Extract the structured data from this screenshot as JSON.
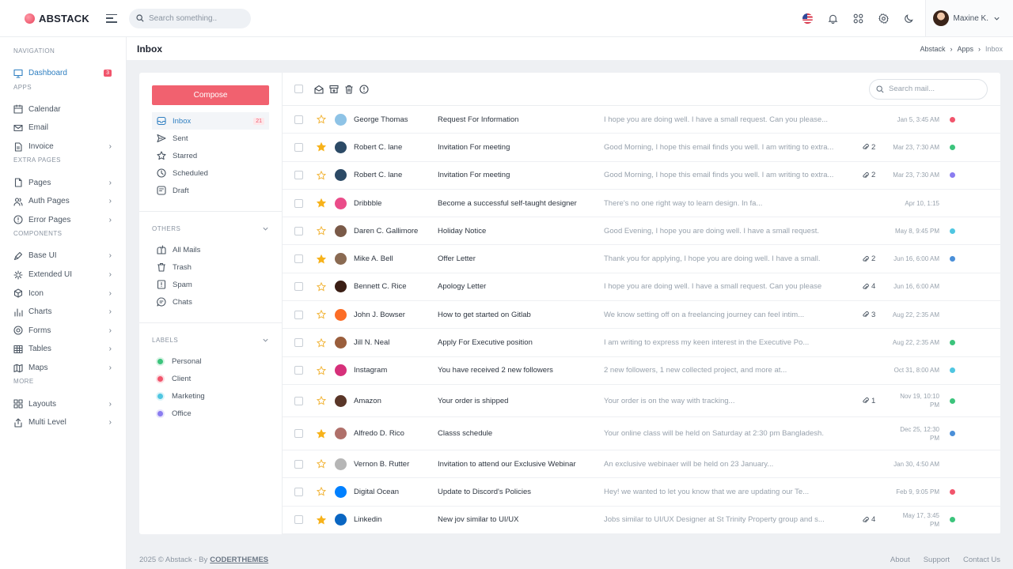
{
  "app": {
    "brand": "ABSTACK",
    "search_placeholder": "Search something..",
    "user_name": "Maxine K."
  },
  "sidebar": {
    "sections": [
      {
        "title": "NAVIGATION",
        "items": [
          {
            "label": "Dashboard",
            "icon": "monitor-icon",
            "badge": "3",
            "active": true
          }
        ]
      },
      {
        "title": "APPS",
        "items": [
          {
            "label": "Calendar",
            "icon": "calendar-icon"
          },
          {
            "label": "Email",
            "icon": "mail-icon"
          },
          {
            "label": "Invoice",
            "icon": "file-icon",
            "chevron": true
          }
        ]
      },
      {
        "title": "EXTRA PAGES",
        "items": [
          {
            "label": "Pages",
            "icon": "page-icon",
            "chevron": true
          },
          {
            "label": "Auth Pages",
            "icon": "users-icon",
            "chevron": true
          },
          {
            "label": "Error Pages",
            "icon": "alert-icon",
            "chevron": true
          }
        ]
      },
      {
        "title": "COMPONENTS",
        "items": [
          {
            "label": "Base UI",
            "icon": "brush-icon",
            "chevron": true
          },
          {
            "label": "Extended UI",
            "icon": "sparkle-icon",
            "chevron": true
          },
          {
            "label": "Icon",
            "icon": "cube-icon",
            "chevron": true
          },
          {
            "label": "Charts",
            "icon": "chart-icon",
            "chevron": true
          },
          {
            "label": "Forms",
            "icon": "target-icon",
            "chevron": true
          },
          {
            "label": "Tables",
            "icon": "table-icon",
            "chevron": true
          },
          {
            "label": "Maps",
            "icon": "map-icon",
            "chevron": true
          }
        ]
      },
      {
        "title": "MORE",
        "items": [
          {
            "label": "Layouts",
            "icon": "layout-icon",
            "chevron": true
          },
          {
            "label": "Multi Level",
            "icon": "share-icon",
            "chevron": true
          }
        ]
      }
    ]
  },
  "page": {
    "title": "Inbox",
    "breadcrumb": [
      "Abstack",
      "Apps",
      "Inbox"
    ]
  },
  "mail_nav": {
    "compose_label": "Compose",
    "folders": [
      {
        "label": "Inbox",
        "count": "21",
        "active": true,
        "icon": "inbox-icon"
      },
      {
        "label": "Sent",
        "icon": "send-icon"
      },
      {
        "label": "Starred",
        "icon": "star-outline-icon"
      },
      {
        "label": "Scheduled",
        "icon": "clock-icon"
      },
      {
        "label": "Draft",
        "icon": "draft-icon"
      }
    ],
    "others_title": "OTHERS",
    "others": [
      {
        "label": "All Mails",
        "icon": "mailbox-icon"
      },
      {
        "label": "Trash",
        "icon": "trash-icon"
      },
      {
        "label": "Spam",
        "icon": "spam-icon"
      },
      {
        "label": "Chats",
        "icon": "chat-icon"
      }
    ],
    "labels_title": "LABELS",
    "labels": [
      {
        "label": "Personal",
        "color": "#3cc47c"
      },
      {
        "label": "Client",
        "color": "#f1556c"
      },
      {
        "label": "Marketing",
        "color": "#4fc6e1"
      },
      {
        "label": "Office",
        "color": "#8a7cf0"
      }
    ]
  },
  "mail_search_placeholder": "Search mail...",
  "emails": [
    {
      "sender": "George Thomas",
      "subject": "Request For Information",
      "preview": "I hope you are doing well. I have a small request. Can you please...",
      "attachments": "",
      "date": "Jan 5, 3:45 AM",
      "starred": false,
      "dot": "#f1556c",
      "avatar_color": "#8ec3e6"
    },
    {
      "sender": "Robert C. lane",
      "subject": "Invitation For meeting",
      "preview": "Good Morning, I hope this email finds you well. I am writing to extra...",
      "attachments": "2",
      "date": "Mar 23, 7:30 AM",
      "starred": true,
      "dot": "#3cc47c",
      "avatar_color": "#2c4a66"
    },
    {
      "sender": "Robert C. lane",
      "subject": "Invitation For meeting",
      "preview": "Good Morning, I hope this email finds you well. I am writing to extra...",
      "attachments": "2",
      "date": "Mar 23, 7:30 AM",
      "starred": false,
      "dot": "#8a7cf0",
      "avatar_color": "#2c4a66"
    },
    {
      "sender": "Dribbble",
      "subject": "Become a successful self-taught designer",
      "preview": "There's no one right way to learn design. In fa...",
      "attachments": "",
      "date": "Apr 10, 1:15",
      "starred": true,
      "dot": "",
      "avatar_color": "#ea4c89"
    },
    {
      "sender": "Daren C. Gallimore",
      "subject": "Holiday Notice",
      "preview": "Good Evening, I hope you are doing well. I have a small request.",
      "attachments": "",
      "date": "May 8, 9:45 PM",
      "starred": false,
      "dot": "#4fc6e1",
      "avatar_color": "#7a5a48"
    },
    {
      "sender": "Mike A. Bell",
      "subject": "Offer Letter",
      "preview": "Thank you for applying, I hope you are doing well. I have a small.",
      "attachments": "2",
      "date": "Jun 16, 6:00 AM",
      "starred": true,
      "dot": "#4a8fd8",
      "avatar_color": "#8a6a52"
    },
    {
      "sender": "Bennett C. Rice",
      "subject": "Apology Letter",
      "preview": "I hope you are doing well. I have a small request. Can you please",
      "attachments": "4",
      "date": "Jun 16, 6:00 AM",
      "starred": false,
      "dot": "",
      "avatar_color": "#3a1e14"
    },
    {
      "sender": "John J. Bowser",
      "subject": "How to get started on Gitlab",
      "preview": "We know setting off on a freelancing journey can feel intim...",
      "attachments": "3",
      "date": "Aug 22, 2:35 AM",
      "starred": false,
      "dot": "",
      "avatar_color": "#fc6d26"
    },
    {
      "sender": "Jill N. Neal",
      "subject": "Apply For Executive position",
      "preview": "I am writing to express my keen interest in the Executive Po...",
      "attachments": "",
      "date": "Aug 22, 2:35 AM",
      "starred": false,
      "dot": "#3cc47c",
      "avatar_color": "#9a5e3c"
    },
    {
      "sender": "Instagram",
      "subject": "You have received 2 new followers",
      "preview": "2 new followers, 1 new collected project, and more at...",
      "attachments": "",
      "date": "Oct 31, 8:00 AM",
      "starred": false,
      "dot": "#4fc6e1",
      "avatar_color": "#d6307a"
    },
    {
      "sender": "Amazon",
      "subject": "Your order is shipped",
      "preview": "Your order is on the way with tracking...",
      "attachments": "1",
      "date": "Nov 19, 10:10 PM",
      "starred": false,
      "dot": "#3cc47c",
      "avatar_color": "#5a3628"
    },
    {
      "sender": "Alfredo D. Rico",
      "subject": "Classs schedule",
      "preview": "Your online class will be held on Saturday at 2:30 pm Bangladesh.",
      "attachments": "",
      "date": "Dec 25, 12:30 PM",
      "starred": true,
      "dot": "#4a8fd8",
      "avatar_color": "#b0706a"
    },
    {
      "sender": "Vernon B. Rutter",
      "subject": "Invitation to attend our Exclusive Webinar",
      "preview": "An exclusive webinaer will be held on 23 January...",
      "attachments": "",
      "date": "Jan 30, 4:50 AM",
      "starred": false,
      "dot": "",
      "avatar_color": "#b6b6b6"
    },
    {
      "sender": "Digital Ocean",
      "subject": "Update to Discord's Policies",
      "preview": "Hey! we wanted to let you know that we are updating our Te...",
      "attachments": "",
      "date": "Feb 9, 9:05 PM",
      "starred": false,
      "dot": "#f1556c",
      "avatar_color": "#0080ff"
    },
    {
      "sender": "Linkedin",
      "subject": "New jov similar to UI/UX",
      "preview": "Jobs similar to UI/UX Designer at St Trinity Property group and s...",
      "attachments": "4",
      "date": "May 17, 3:45 PM",
      "starred": true,
      "dot": "#3cc47c",
      "avatar_color": "#0a66c2"
    }
  ],
  "footer": {
    "copyright": "2025 © Abstack - By",
    "brand": "CODERTHEMES",
    "links": [
      "About",
      "Support",
      "Contact Us"
    ]
  },
  "colors": {
    "accent": "#2f7fc1",
    "compose": "#f1616f",
    "star": "#f7b21a"
  }
}
